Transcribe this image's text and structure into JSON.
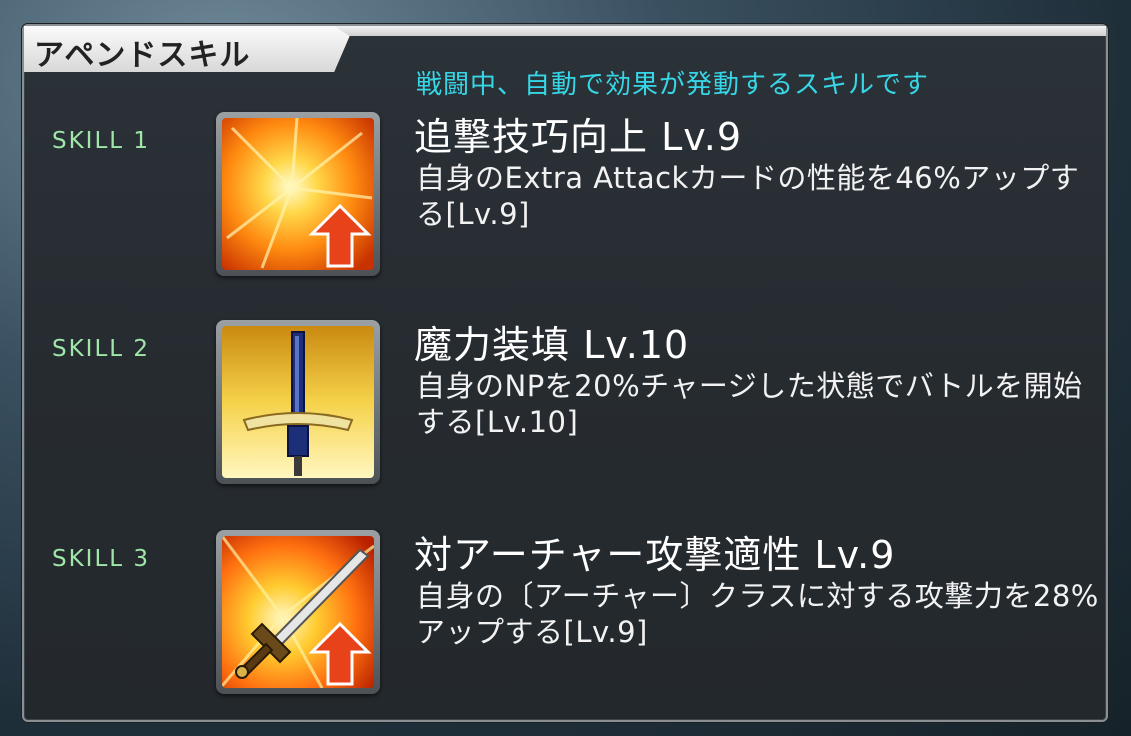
{
  "header": {
    "title": "アペンドスキル",
    "subtitle": "戦闘中、自動で効果が発動するスキルです"
  },
  "skills": [
    {
      "label": "SKILL 1",
      "icon": "explosion-up-icon",
      "name": "追撃技巧向上 Lv.9",
      "desc": "自身のExtra Attackカードの性能を46%アップする[Lv.9]"
    },
    {
      "label": "SKILL 2",
      "icon": "sword-charge-icon",
      "name": "魔力装填 Lv.10",
      "desc": "自身のNPを20%チャージした状態でバトルを開始する[Lv.10]"
    },
    {
      "label": "SKILL 3",
      "icon": "sword-up-icon",
      "name": "対アーチャー攻撃適性 Lv.9",
      "desc": "自身の〔アーチャー〕クラスに対する攻撃力を28%アップする[Lv.9]"
    }
  ],
  "colors": {
    "accent": "#36d6e6",
    "skill_label": "#9fe6a8",
    "up_arrow": "#e8421a"
  }
}
